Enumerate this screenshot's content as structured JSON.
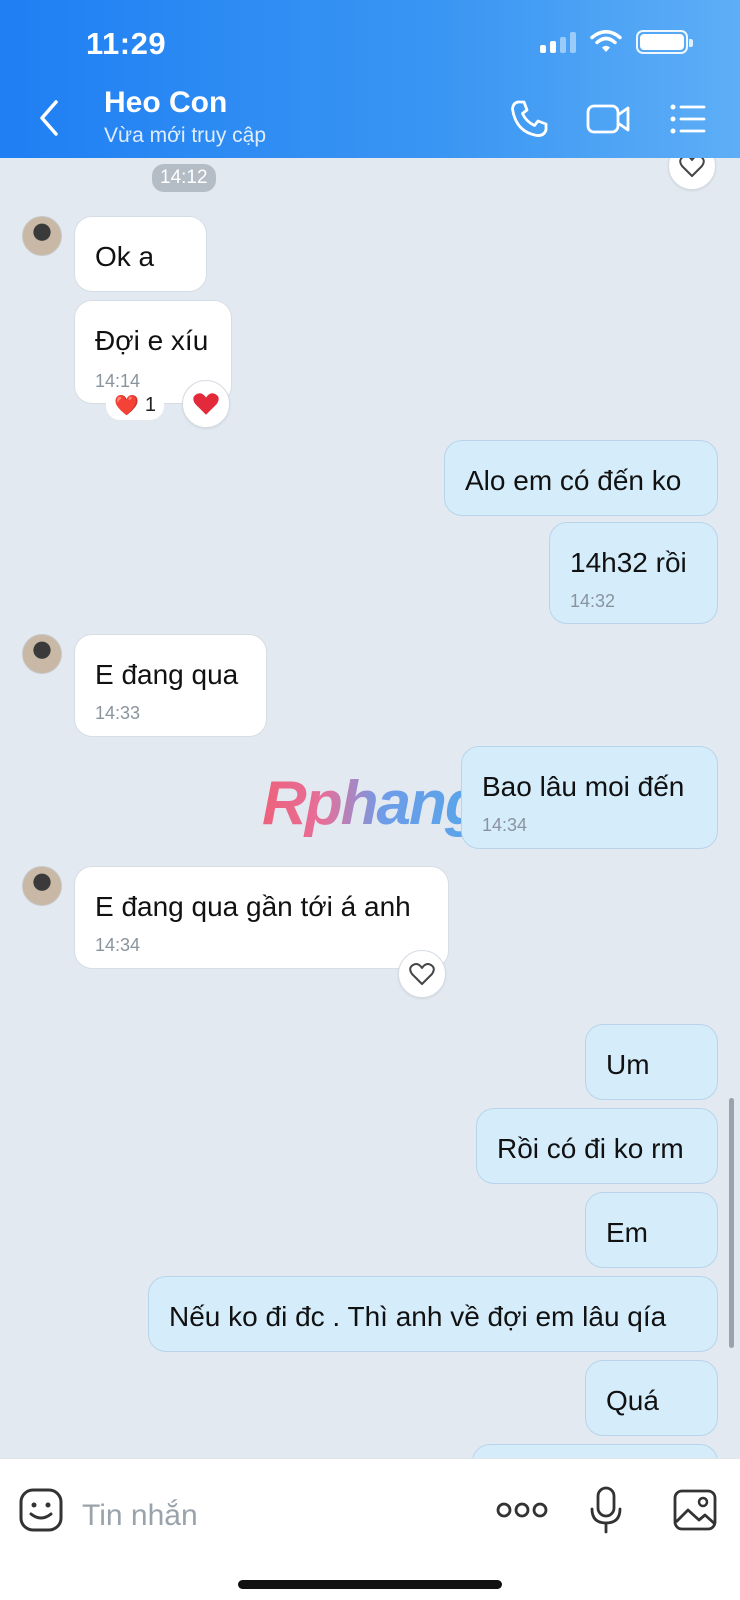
{
  "status_bar": {
    "time": "11:29"
  },
  "header": {
    "contact_name": "Heo Con",
    "contact_status": "Vừa mới truy cập",
    "icons": [
      "back-icon",
      "phone-icon",
      "video-call-icon",
      "menu-list-icon"
    ]
  },
  "chat": {
    "date_pill": "14:12",
    "messages": [
      {
        "direction": "in",
        "text": "Ok a",
        "time": ""
      },
      {
        "direction": "in",
        "text": "Đợi e xíu",
        "time": "14:14",
        "reaction": {
          "emoji": "❤️",
          "count": "1"
        }
      },
      {
        "direction": "out",
        "text": "Alo em có đến ko",
        "time": ""
      },
      {
        "direction": "out",
        "text": "14h32 rồi",
        "time": "14:32"
      },
      {
        "direction": "in",
        "text": "E đang qua",
        "time": "14:33"
      },
      {
        "direction": "out",
        "text": "Bao lâu moi đến",
        "time": "14:34"
      },
      {
        "direction": "in",
        "text": "E đang qua gần tới á anh",
        "time": "14:34"
      },
      {
        "direction": "out",
        "text": "Um",
        "time": ""
      },
      {
        "direction": "out",
        "text": "Rồi có đi ko rm",
        "time": ""
      },
      {
        "direction": "out",
        "text": "Em",
        "time": ""
      },
      {
        "direction": "out",
        "text": "Nếu ko đi đc . Thì anh về đợi em lâu qía",
        "time": ""
      },
      {
        "direction": "out",
        "text": "Quá",
        "time": ""
      }
    ],
    "watermark": "Rphang"
  },
  "composer": {
    "placeholder": "Tin nhắn",
    "icons": [
      "sticker-icon",
      "more-options-icon",
      "microphone-icon",
      "image-icon"
    ]
  },
  "colors": {
    "header_start": "#1f7ff3",
    "header_end": "#5eaef6",
    "bubble_out": "#d5ecfb",
    "bubble_in": "#ffffff",
    "chat_bg": "#e2e9f1"
  }
}
